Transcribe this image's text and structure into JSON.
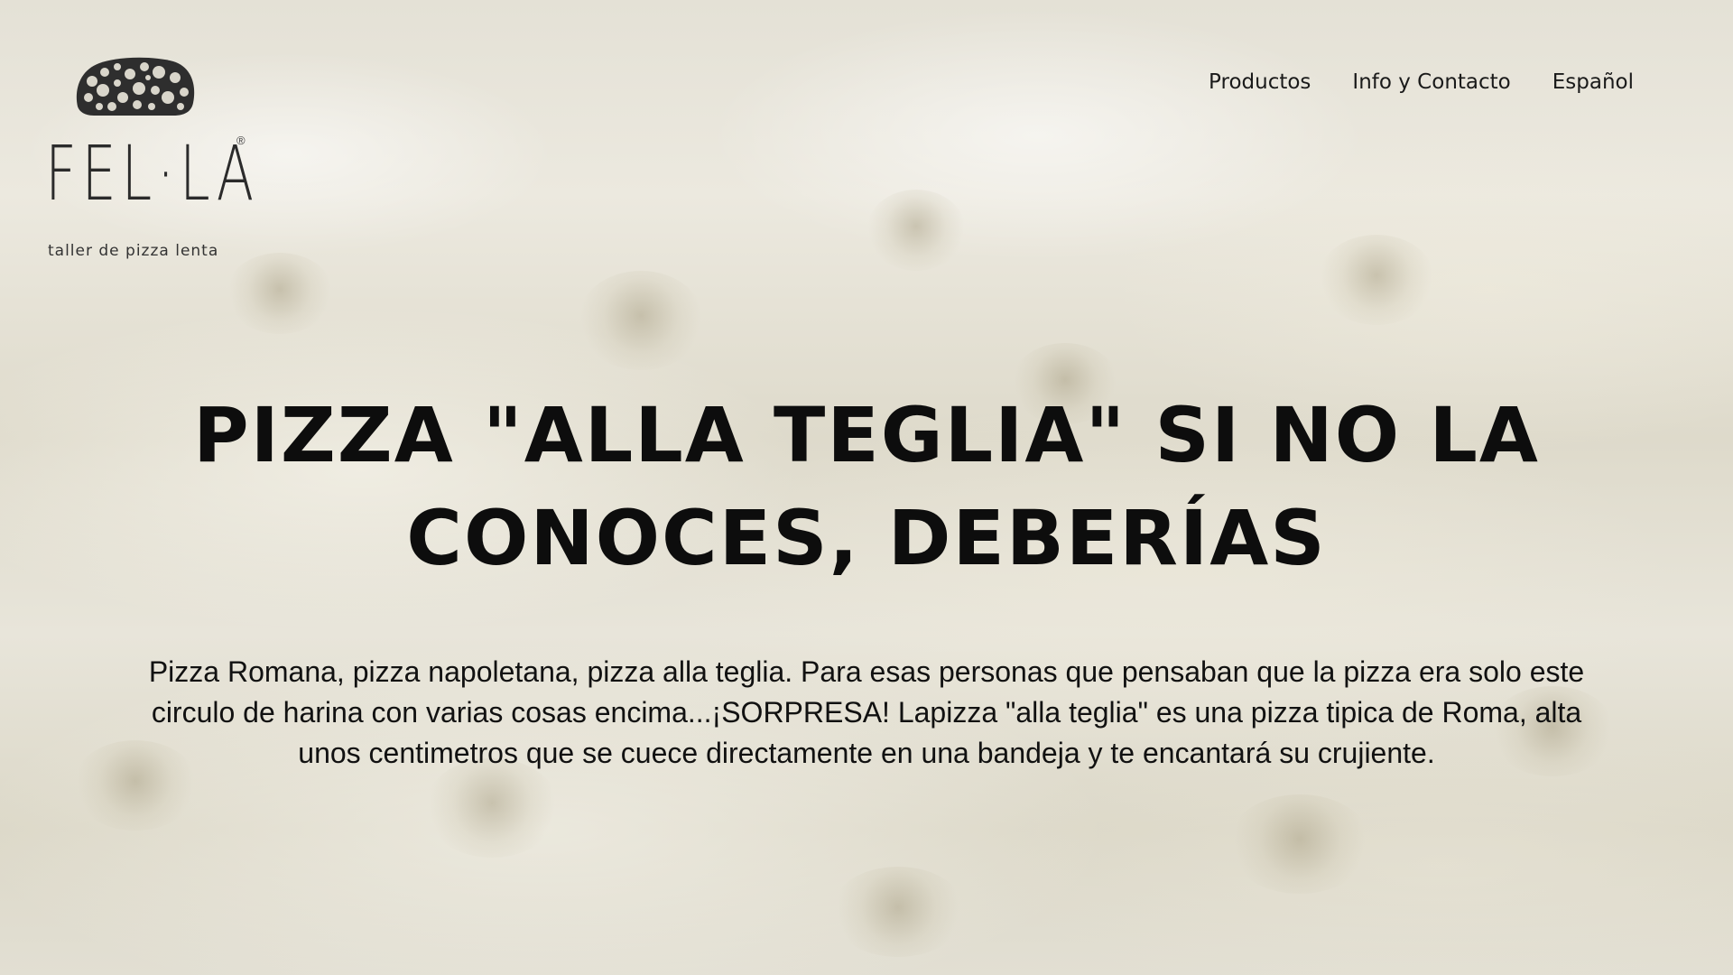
{
  "brand": {
    "name": "FEL·LA",
    "registered_mark": "®",
    "tagline": "taller de pizza lenta",
    "bread_icon": "bread-loaf-bubbles-icon"
  },
  "nav": {
    "items": [
      {
        "label": "Productos"
      },
      {
        "label": "Info y Contacto"
      },
      {
        "label": "Español"
      }
    ]
  },
  "hero": {
    "headline": "PIZZA \"ALLA TEGLIA\" SI NO LA CONOCES, DEBERÍAS",
    "paragraph": "Pizza Romana, pizza napoletana, pizza alla teglia. Para esas personas que pensaban que la pizza era solo este circulo de harina con varias cosas encima...¡SORPRESA! Lapizza \"alla teglia\" es una pizza tipica de Roma, alta unos centimetros que se cuece directamente en una bandeja y te encantará su crujiente."
  },
  "colors": {
    "text": "#111111",
    "dough_light": "#ece9df",
    "dough_shadow": "#dedacb"
  }
}
